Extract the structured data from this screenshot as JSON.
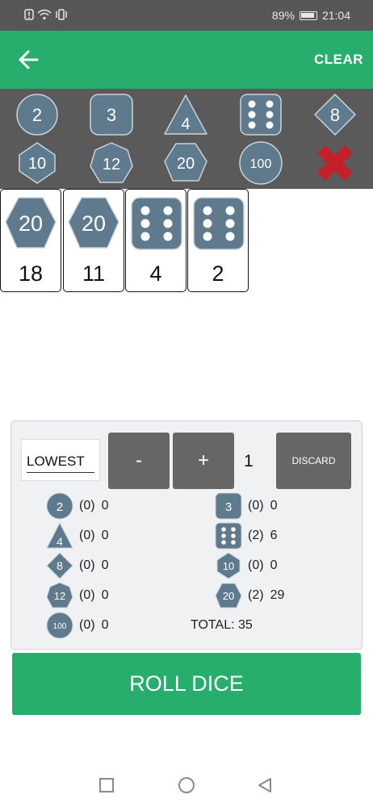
{
  "status": {
    "battery": "89%",
    "time": "21:04"
  },
  "header": {
    "clear_label": "CLEAR"
  },
  "palette": [
    {
      "name": "d2",
      "label": "2"
    },
    {
      "name": "d3",
      "label": "3"
    },
    {
      "name": "d4",
      "label": "4"
    },
    {
      "name": "d6",
      "label": ""
    },
    {
      "name": "d8",
      "label": "8"
    },
    {
      "name": "d10",
      "label": "10"
    },
    {
      "name": "d12",
      "label": "12"
    },
    {
      "name": "d20",
      "label": "20"
    },
    {
      "name": "d100",
      "label": "100"
    },
    {
      "name": "remove",
      "label": ""
    }
  ],
  "rolled": [
    {
      "die": "20",
      "value": "18"
    },
    {
      "die": "20",
      "value": "11"
    },
    {
      "die": "6",
      "value": "4"
    },
    {
      "die": "6",
      "value": "2"
    }
  ],
  "controls": {
    "select_value": "LOWEST",
    "minus_label": "-",
    "plus_label": "+",
    "count": "1",
    "discard_label": "DISCARD"
  },
  "summary": {
    "left": [
      {
        "label": "2",
        "count": "(0)",
        "sum": "0"
      },
      {
        "label": "4",
        "count": "(0)",
        "sum": "0"
      },
      {
        "label": "8",
        "count": "(0)",
        "sum": "0"
      },
      {
        "label": "12",
        "count": "(0)",
        "sum": "0"
      },
      {
        "label": "100",
        "count": "(0)",
        "sum": "0"
      }
    ],
    "right": [
      {
        "label": "3",
        "count": "(0)",
        "sum": "0"
      },
      {
        "label": "",
        "count": "(2)",
        "sum": "6"
      },
      {
        "label": "10",
        "count": "(0)",
        "sum": "0"
      },
      {
        "label": "20",
        "count": "(2)",
        "sum": "29"
      }
    ],
    "total": "TOTAL: 35"
  },
  "roll_label": "ROLL DICE",
  "colors": {
    "accent": "#27ae6d",
    "die": "#5e7a8c",
    "palette_bg": "#5a5a5a",
    "remove": "#c3202b"
  }
}
